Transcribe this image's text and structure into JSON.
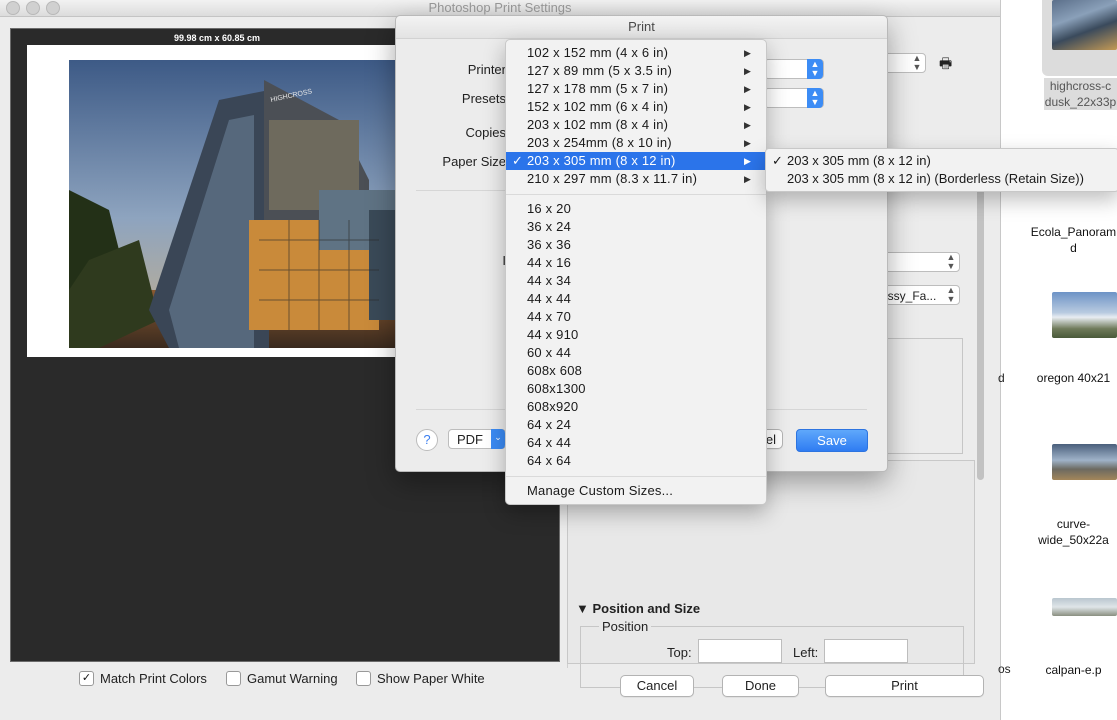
{
  "window": {
    "title": "Photoshop Print Settings"
  },
  "preview": {
    "dimensions": "99.98 cm x 60.85 cm"
  },
  "checkboxes": [
    {
      "label": "Match Print Colors",
      "checked": true
    },
    {
      "label": "Gamut Warning",
      "checked": false
    },
    {
      "label": "Show Paper White",
      "checked": false
    }
  ],
  "bottom_buttons": {
    "cancel": "Cancel",
    "done": "Done",
    "print": "Print"
  },
  "position_size": {
    "title": "Position and Size",
    "legend": "Position",
    "top_label": "Top:",
    "left_label": "Left:"
  },
  "bg_values": {
    "paper_type": "ssy",
    "paper_profile": "ossy_Fa...",
    "dot_line": "."
  },
  "print_dialog": {
    "title": "Print",
    "labels": {
      "printer": "Printer",
      "presets": "Presets",
      "copies": "Copies",
      "paper_size": "Paper Size",
      "layout_partial": "I"
    },
    "pdf": "PDF",
    "cancel_partial": "el",
    "save": "Save"
  },
  "paper_menu": {
    "items": [
      {
        "label": "102 x 152 mm (4 x 6 in)",
        "submenu": true
      },
      {
        "label": "127 x 89 mm (5 x 3.5 in)",
        "submenu": true
      },
      {
        "label": "127 x 178 mm (5 x 7 in)",
        "submenu": true
      },
      {
        "label": "152 x 102 mm (6 x 4 in)",
        "submenu": true
      },
      {
        "label": "203 x 102 mm (8 x 4 in)",
        "submenu": true
      },
      {
        "label": "203 x 254mm (8 x 10 in)",
        "submenu": true
      },
      {
        "label": "203 x 305 mm (8 x 12 in)",
        "submenu": true,
        "selected": true
      },
      {
        "label": "210 x 297 mm (8.3 x 11.7 in)",
        "submenu": true
      }
    ],
    "custom_items": [
      "16 x 20",
      "36 x 24",
      "36 x 36",
      "44 x 16",
      "44 x 34",
      "44 x 44",
      "44 x 70",
      "44 x 910",
      "60 x 44",
      "608x 608",
      "608x1300",
      "608x920",
      "64 x 24",
      "64 x 44",
      "64 x 64"
    ],
    "manage": "Manage Custom Sizes...",
    "submenu": [
      {
        "label": "203 x 305 mm (8 x 12 in)",
        "checked": true
      },
      {
        "label": "203 x 305 mm (8 x 12 in) (Borderless (Retain Size))",
        "checked": false
      }
    ]
  },
  "desktop": {
    "items": [
      {
        "label": "highcross-dusk_22x33p",
        "lines": [
          "highcross-c",
          "dusk_22x33p"
        ]
      },
      {
        "label": "Ecola_Panoramad",
        "lines": [
          "Ecola_Panoram",
          "d"
        ]
      },
      {
        "label": "oregon 40x21",
        "lines": [
          "oregon 40x21"
        ]
      },
      {
        "label": "curve-wide_50x22a",
        "lines": [
          "curve-",
          "wide_50x22a"
        ]
      },
      {
        "label": "calpan-e.p",
        "lines": [
          "calpan-e.p"
        ]
      }
    ],
    "partial_labels": [
      "d",
      "os"
    ]
  }
}
